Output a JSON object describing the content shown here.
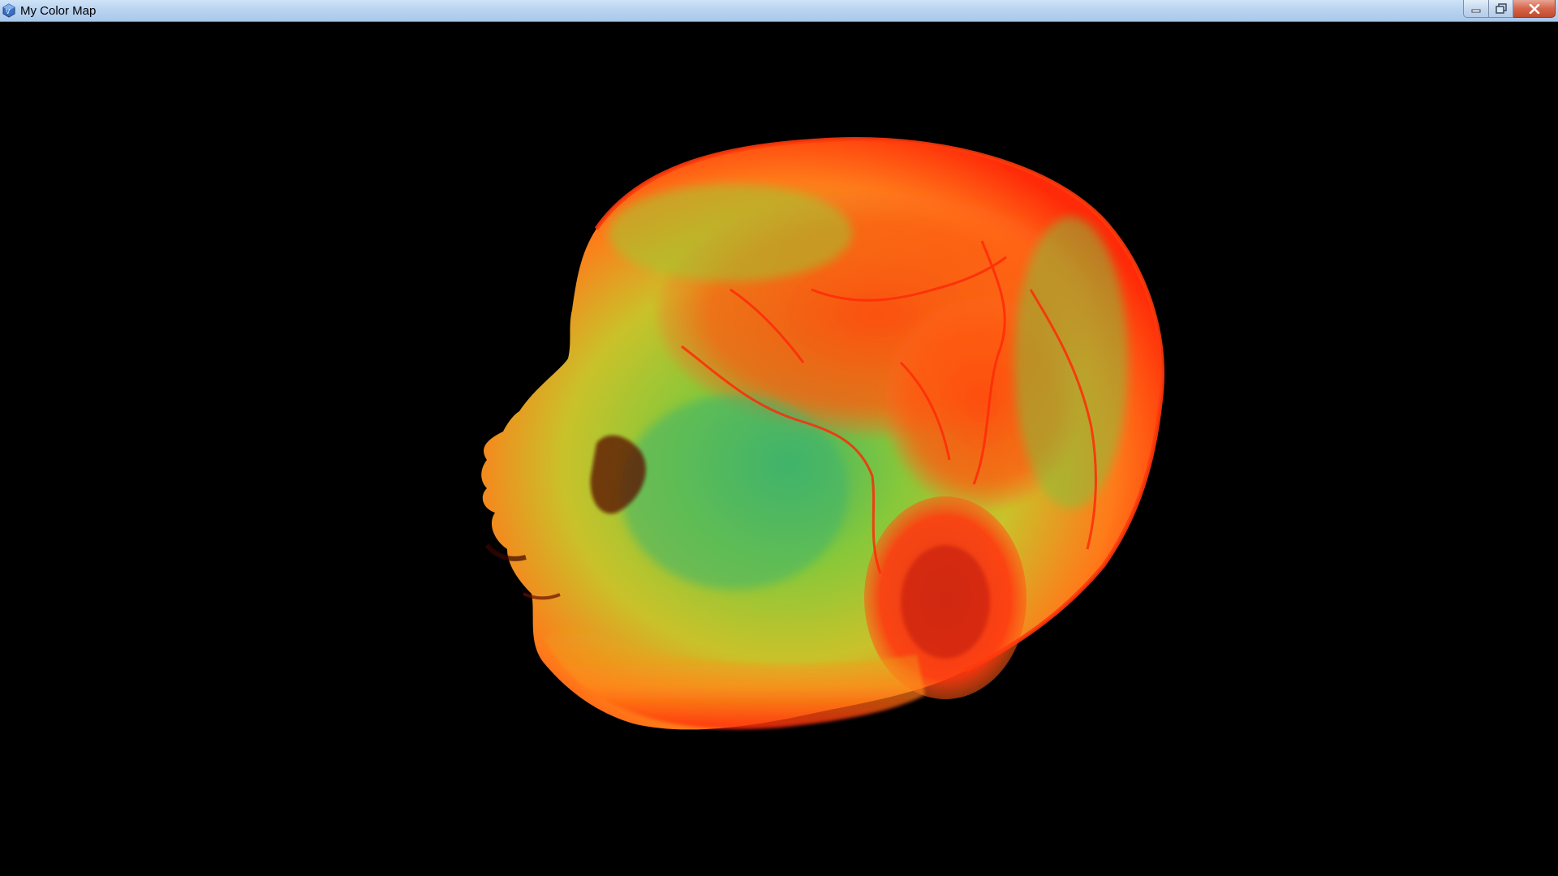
{
  "window": {
    "title": "My Color Map",
    "app_icon": "vtk-app-icon",
    "controls": {
      "minimize": "minimize-icon",
      "maximize": "maximize-icon",
      "close": "close-icon"
    }
  },
  "viewport": {
    "background_color": "#000000",
    "content": "volume-rendered-head",
    "colormap": [
      "#2bb36b",
      "#9acb2e",
      "#f0c21a",
      "#ff6a1a",
      "#ff2a0a"
    ]
  }
}
